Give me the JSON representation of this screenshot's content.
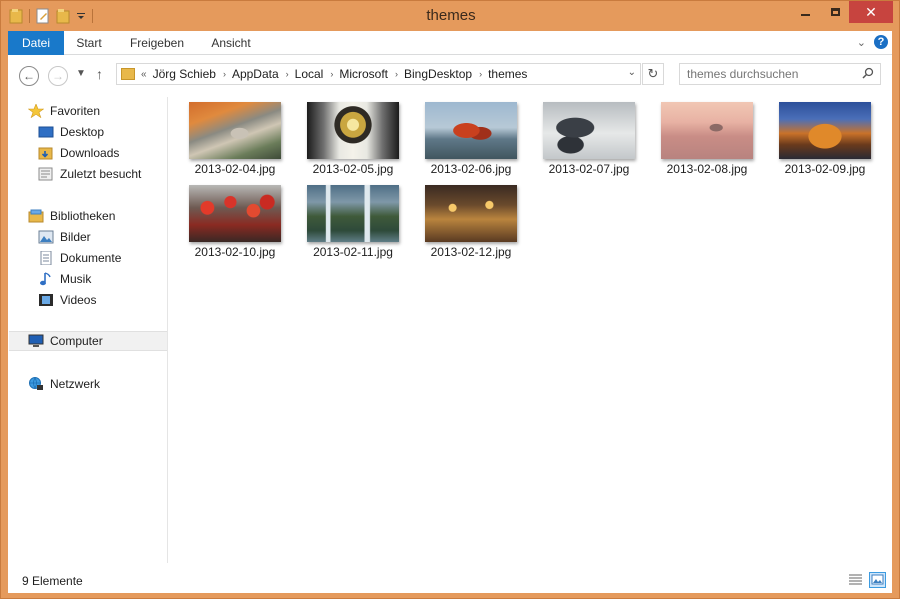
{
  "window": {
    "title": "themes"
  },
  "ribbon": {
    "tabs": [
      {
        "label": "Datei"
      },
      {
        "label": "Start"
      },
      {
        "label": "Freigeben"
      },
      {
        "label": "Ansicht"
      }
    ]
  },
  "address": {
    "prefix": "«",
    "breadcrumbs": [
      "Jörg Schieb",
      "AppData",
      "Local",
      "Microsoft",
      "BingDesktop",
      "themes"
    ],
    "separator": "›"
  },
  "search": {
    "placeholder": "themes durchsuchen"
  },
  "navigation": {
    "favorites": {
      "label": "Favoriten",
      "items": [
        "Desktop",
        "Downloads",
        "Zuletzt besucht"
      ]
    },
    "libraries": {
      "label": "Bibliotheken",
      "items": [
        "Bilder",
        "Dokumente",
        "Musik",
        "Videos"
      ]
    },
    "computer": {
      "label": "Computer"
    },
    "network": {
      "label": "Netzwerk"
    }
  },
  "files": [
    {
      "name": "2013-02-04.jpg"
    },
    {
      "name": "2013-02-05.jpg"
    },
    {
      "name": "2013-02-06.jpg"
    },
    {
      "name": "2013-02-07.jpg"
    },
    {
      "name": "2013-02-08.jpg"
    },
    {
      "name": "2013-02-09.jpg"
    },
    {
      "name": "2013-02-10.jpg"
    },
    {
      "name": "2013-02-11.jpg"
    },
    {
      "name": "2013-02-12.jpg"
    }
  ],
  "status": {
    "item_count": "9 Elemente"
  },
  "colors": {
    "frame": "#e59a5c",
    "accent": "#1979ca",
    "close": "#c7443f"
  }
}
